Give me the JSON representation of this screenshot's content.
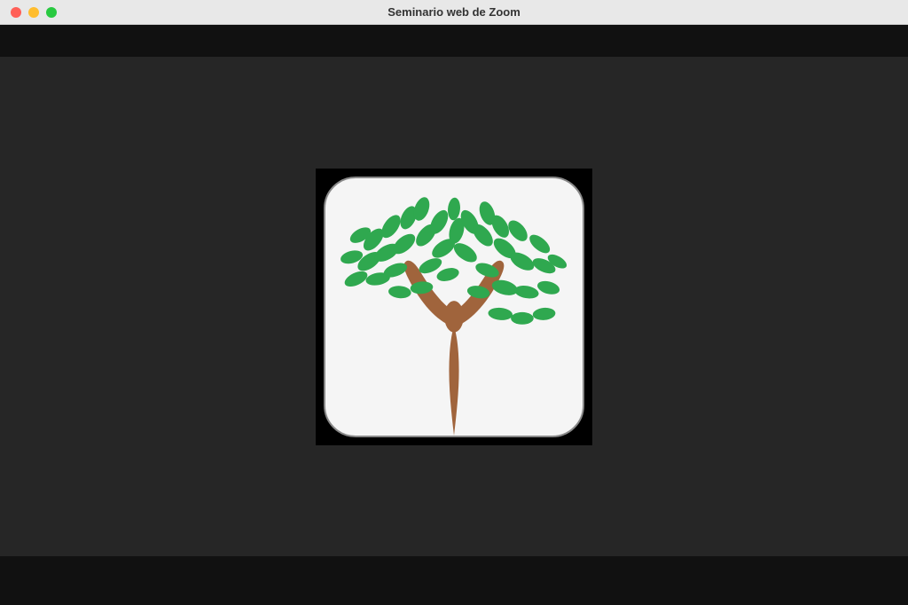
{
  "window": {
    "title": "Seminario web de Zoom"
  },
  "colors": {
    "titlebar_bg": "#e8e8e8",
    "toolbar_bg": "#111111",
    "content_bg": "#262626",
    "tile_bg": "#000000",
    "avatar_bg": "#f5f5f5",
    "tree_green": "#2fa84f",
    "tree_brown": "#a0643c"
  },
  "participant": {
    "avatar_type": "tree-person-icon"
  }
}
